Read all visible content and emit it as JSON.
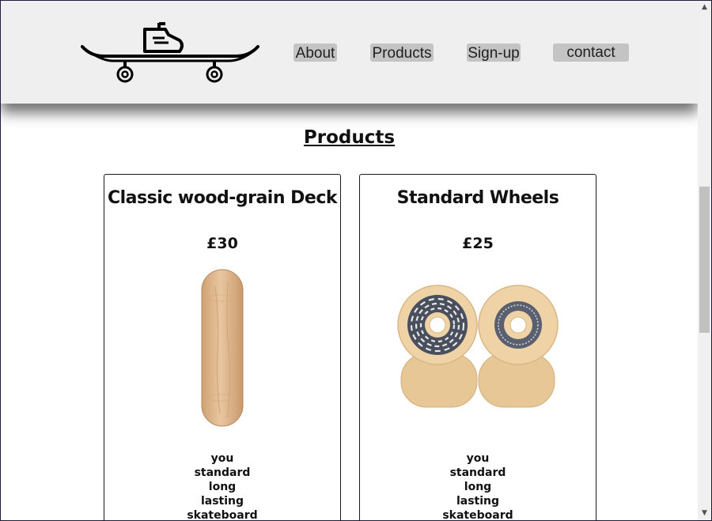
{
  "header": {
    "logo_icon": "skateboard-with-shoe-logo",
    "nav": [
      {
        "label": "About"
      },
      {
        "label": "Products"
      },
      {
        "label": "Sign-up"
      },
      {
        "label": "contact"
      }
    ]
  },
  "main": {
    "title": "Products",
    "products": [
      {
        "title": "Classic wood-grain Deck",
        "price": "£30",
        "image_icon": "skateboard-deck-image",
        "description": [
          "you",
          "standard",
          "long",
          "lasting",
          "skateboard"
        ]
      },
      {
        "title": "Standard Wheels",
        "price": "£25",
        "image_icon": "skateboard-wheels-image",
        "description": [
          "you",
          "standard",
          "long",
          "lasting",
          "skateboard"
        ]
      }
    ]
  },
  "colors": {
    "header_bg": "#efefef",
    "nav_button_bg": "#c4c4c4",
    "deck_wood": "#e2bc92",
    "wheel_cream": "#efd3a6"
  }
}
